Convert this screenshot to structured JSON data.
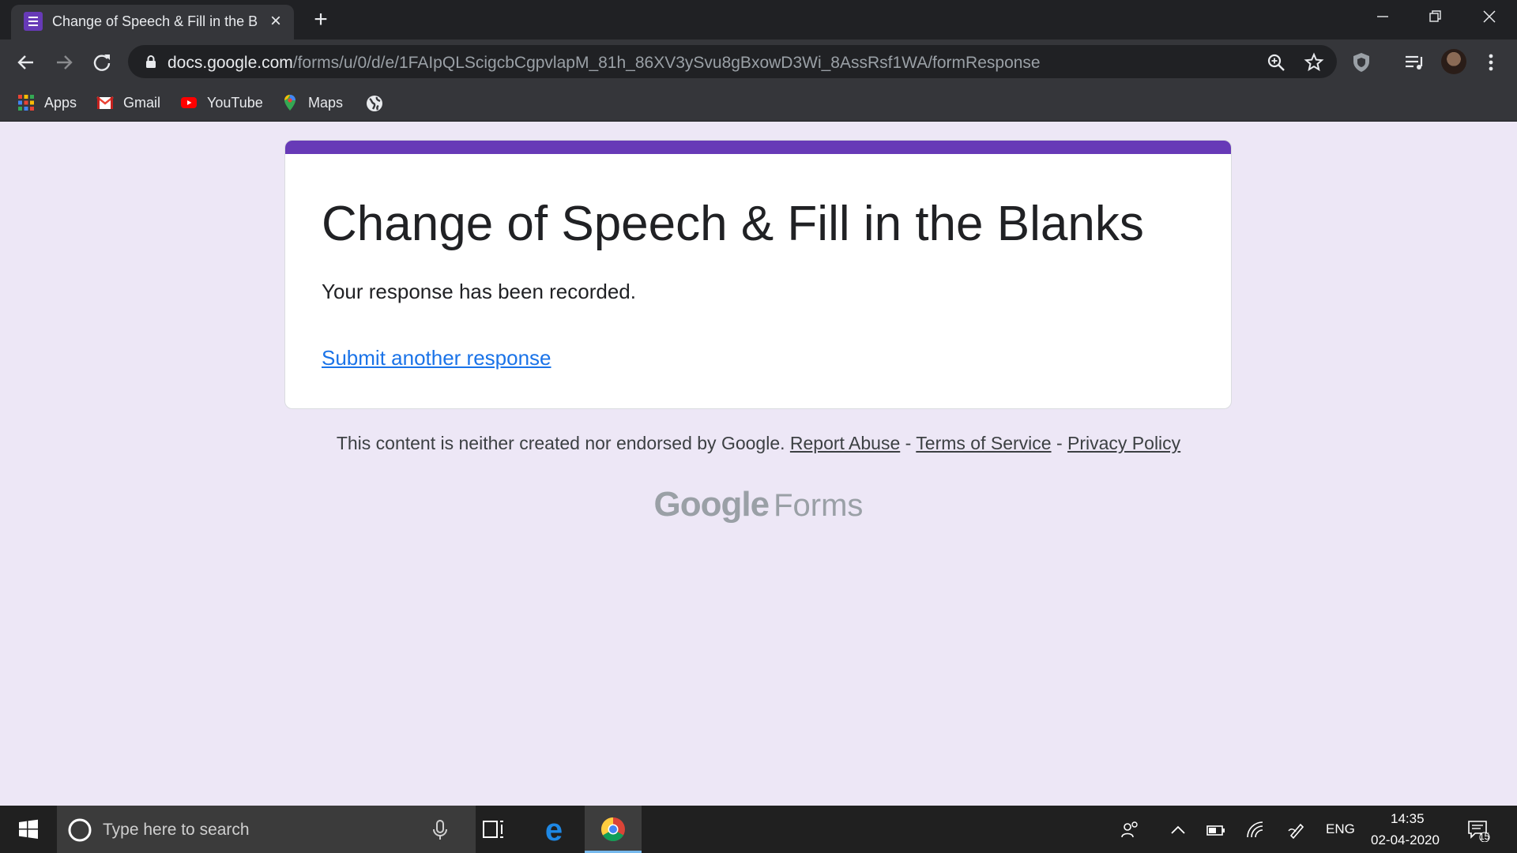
{
  "browser": {
    "tab_title": "Change of Speech & Fill in the Blanks",
    "url_host": "docs.google.com",
    "url_path": "/forms/u/0/d/e/1FAIpQLScigcbCgpvlapM_81h_86XV3ySvu8gBxowD3Wi_8AssRsf1WA/formResponse"
  },
  "bookmarks": [
    {
      "label": "Apps",
      "icon": "apps-grid-icon"
    },
    {
      "label": "Gmail",
      "icon": "gmail-icon"
    },
    {
      "label": "YouTube",
      "icon": "youtube-icon"
    },
    {
      "label": "Maps",
      "icon": "maps-pin-icon"
    }
  ],
  "form": {
    "title": "Change of Speech & Fill in the Blanks",
    "confirmation": "Your response has been recorded.",
    "submit_another": "Submit another response",
    "accent_color": "#673ab7"
  },
  "footer": {
    "disclaimer": "This content is neither created nor endorsed by Google.",
    "report_abuse": "Report Abuse",
    "sep1": " - ",
    "terms": "Terms of Service",
    "sep2": " - ",
    "privacy": "Privacy Policy",
    "brand_google": "Google",
    "brand_forms": "Forms"
  },
  "taskbar": {
    "search_placeholder": "Type here to search",
    "language": "ENG",
    "time": "14:35",
    "date": "02-04-2020",
    "notification_count": "15"
  }
}
